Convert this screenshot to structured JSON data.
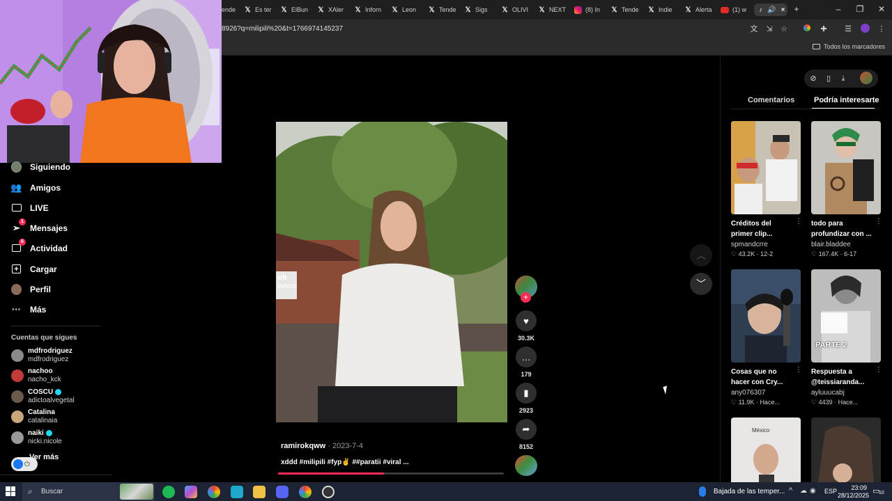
{
  "browser": {
    "tabs": [
      {
        "label": "ende",
        "icon": "x-icon"
      },
      {
        "label": "Es ter",
        "icon": "x-icon"
      },
      {
        "label": "ElBun",
        "icon": "x-icon"
      },
      {
        "label": "XAler",
        "icon": "x-icon"
      },
      {
        "label": "Inforn",
        "icon": "x-icon"
      },
      {
        "label": "Leon",
        "icon": "x-icon"
      },
      {
        "label": "Tende",
        "icon": "x-icon"
      },
      {
        "label": "Sigs",
        "icon": "x-icon"
      },
      {
        "label": "OLIVI",
        "icon": "x-icon"
      },
      {
        "label": "NEXT",
        "icon": "x-icon"
      },
      {
        "label": "(8) In",
        "icon": "instagram-icon"
      },
      {
        "label": "Tende",
        "icon": "x-icon"
      },
      {
        "label": "Indie",
        "icon": "x-icon"
      },
      {
        "label": "Alerta",
        "icon": "x-icon"
      },
      {
        "label": "(1) w",
        "icon": "youtube-icon"
      }
    ],
    "url": "8926?q=milipili%20&t=1766974145237",
    "bookmarks_all": "Todos los marcadores"
  },
  "sidebar": {
    "nav": [
      {
        "label": "Siguiendo",
        "icon": "following-icon"
      },
      {
        "label": "Amigos",
        "icon": "friends-icon"
      },
      {
        "label": "LIVE",
        "icon": "live-icon"
      },
      {
        "label": "Mensajes",
        "icon": "messages-icon",
        "badge": "1"
      },
      {
        "label": "Actividad",
        "icon": "activity-icon",
        "badge": "6"
      },
      {
        "label": "Cargar",
        "icon": "upload-icon"
      },
      {
        "label": "Perfil",
        "icon": "profile-icon"
      },
      {
        "label": "Más",
        "icon": "more-icon"
      }
    ],
    "following_heading": "Cuentas que sigues",
    "accounts": [
      {
        "name": "mdfrodriguez",
        "handle": "mdfrodriguez",
        "verified": false
      },
      {
        "name": "nachoo",
        "handle": "nacho_kck",
        "verified": false
      },
      {
        "name": "COSCU",
        "handle": "adictoalvegetal",
        "verified": true
      },
      {
        "name": "Catalina",
        "handle": "catalinaia",
        "verified": false
      },
      {
        "name": "naiki",
        "handle": "nicki.nicole",
        "verified": true
      }
    ],
    "see_more": "Ver más"
  },
  "video": {
    "watermark_line1": "ok",
    "watermark_line2": "taneur",
    "author": "ramirokqww",
    "date": "2023-7-4",
    "caption": "xddd #milipili #fyp✌️ ##paratii #viral ...",
    "progress": 0.47,
    "likes": "30.3K",
    "comments": "179",
    "saves": "2923",
    "shares": "8152"
  },
  "right_panel": {
    "tab_comments": "Comentarios",
    "tab_suggested": "Podría interesarte",
    "suggestions": [
      {
        "title": "Créditos del primer clip...",
        "user": "spmandcrre",
        "likes": "43.2K",
        "date": "12-2"
      },
      {
        "title": "todo para profundizar con ...",
        "user": "blair.bladdee",
        "likes": "167.4K",
        "date": "6-17"
      },
      {
        "title": "Cosas que no hacer con Cry...",
        "user": "any076307",
        "likes": "11.9K",
        "date": "Hace..."
      },
      {
        "title": "Respuesta a @teissiaranda...",
        "user": "ayluuucabj",
        "likes": "4439",
        "date": "Hace...",
        "overlay": "PARTE 2"
      },
      {
        "title": "",
        "user": "",
        "likes": "",
        "date": "",
        "overlay": "México"
      },
      {
        "title": "",
        "user": "",
        "likes": "",
        "date": ""
      }
    ]
  },
  "taskbar": {
    "search_placeholder": "Buscar",
    "news": "Bajada de las temper...",
    "lang": "ESP",
    "time": "23:09",
    "date": "28/12/2025",
    "notif_count": "10"
  },
  "colors": {
    "accent": "#fe2c55",
    "verified": "#20d5ec",
    "taskbar": "#1c2433"
  }
}
